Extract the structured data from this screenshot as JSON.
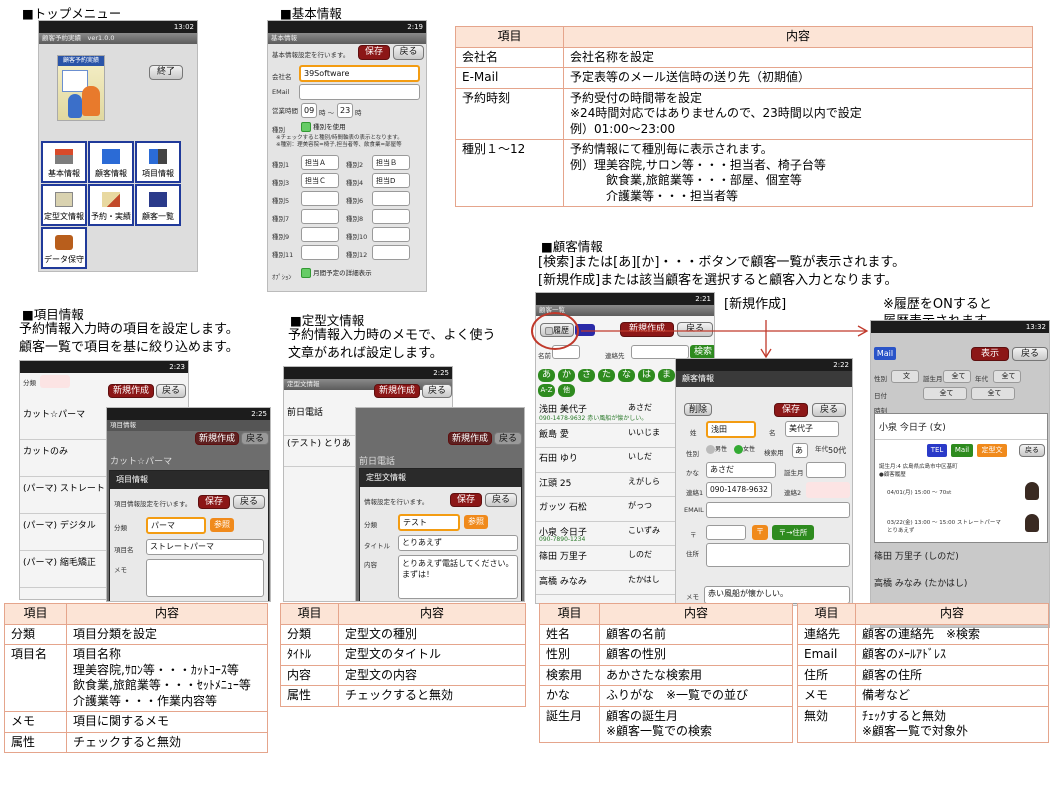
{
  "top_menu": {
    "heading": "■トップメニュー",
    "clock": "13:02",
    "app_title": "顧客予約実績　ver1.0.0",
    "logo_text": "顧客予約実績",
    "exit_label": "終了",
    "items": [
      "基本情報",
      "顧客情報",
      "項目情報",
      "定型文情報",
      "予約・実績",
      "顧客一覧",
      "データ保守"
    ]
  },
  "basic": {
    "heading": "■基本情報",
    "clock": "2:19",
    "title": "基本情報",
    "note": "基本情報設定を行います。",
    "save": "保存",
    "back": "戻る",
    "company_label": "会社名",
    "company_value": "39Software",
    "email_label": "EMail",
    "hours_label": "営業時間",
    "hour_from": "09",
    "hour_sep": "時 〜",
    "hour_to": "23",
    "hour_unit": "時",
    "type_label": "種別",
    "type_check": "種別を使用",
    "type_note1": "※チェックすると種別/時間軸表の表示となります。",
    "type_note2": "※種別：理美容院=椅子,担当者等、飲食業=部屋等",
    "rows": [
      {
        "l1": "種別1",
        "v1": "担当Ａ",
        "l2": "種別2",
        "v2": "担当Ｂ"
      },
      {
        "l1": "種別3",
        "v1": "担当Ｃ",
        "l2": "種別4",
        "v2": "担当D"
      },
      {
        "l1": "種別5",
        "v1": "",
        "l2": "種別6",
        "v2": ""
      },
      {
        "l1": "種別7",
        "v1": "",
        "l2": "種別8",
        "v2": ""
      },
      {
        "l1": "種別9",
        "v1": "",
        "l2": "種別10",
        "v2": ""
      },
      {
        "l1": "種別11",
        "v1": "",
        "l2": "種別12",
        "v2": ""
      }
    ],
    "option_label": "ｵﾌﾟｼｮﾝ",
    "option_check": "月間予定の詳細表示"
  },
  "basic_table": {
    "headers": [
      "項目",
      "内容"
    ],
    "rows": [
      {
        "k": "会社名",
        "v": "会社名称を設定"
      },
      {
        "k": "E-Mail",
        "v": "予定表等のメール送信時の送り先（初期値）"
      },
      {
        "k": "予約時刻",
        "v": "予約受付の時間帯を設定\n※24時間対応ではありませんので、23時間以内で設定\n例）01:00〜23:00"
      },
      {
        "k": "種別１〜12",
        "v": "予約情報にて種別毎に表示されます。\n例）理美容院,サロン等・・・担当者、椅子台等\n　　　飲食業,旅館業等・・・部屋、個室等\n　　　介護業等・・・担当者等"
      }
    ]
  },
  "item_info": {
    "heading": "■項目情報",
    "desc1": "予約情報入力時の項目を設定します。",
    "desc2": "顧客一覧で項目を基に絞り込めます。",
    "clock1": "2:23",
    "clock2": "2:25",
    "list_label": "分類",
    "new": "新規作成",
    "back": "戻る",
    "list": [
      "カット☆パーマ",
      "カットのみ",
      "(パーマ) ストレート",
      "(パーマ) デジタル",
      "(パーマ) 縮毛矯正"
    ],
    "bg_title": "項目情報",
    "bg_item": "カット☆パーマ",
    "dlg_title": "項目情報",
    "dlg_note": "項目情報設定を行います。",
    "save": "保存",
    "cat_label": "分類",
    "cat_value": "パーマ",
    "ref": "参照",
    "name_label": "項目名",
    "name_value": "ストレートパーマ",
    "memo_label": "メモ"
  },
  "item_table": {
    "headers": [
      "項目",
      "内容"
    ],
    "rows": [
      {
        "k": "分類",
        "v": "項目分類を設定"
      },
      {
        "k": "項目名",
        "v": "項目名称\n理美容院,ｻﾛﾝ等・・・ｶｯﾄｺｰｽ等\n飲食業,旅館業等・・・ｾｯﾄﾒﾆｭｰ等\n介護業等・・・作業内容等"
      },
      {
        "k": "メモ",
        "v": "項目に関するメモ"
      },
      {
        "k": "属性",
        "v": "チェックすると無効"
      }
    ]
  },
  "template": {
    "heading": "■定型文情報",
    "desc1": "予約情報入力時のメモで、よく使う",
    "desc2": "文章があれば設定します。",
    "clock1": "2:25",
    "title": "定型文情報",
    "new": "新規作成",
    "back": "戻る",
    "list": [
      "前日電話",
      "(テスト) とりあ"
    ],
    "bg_item": "前日電話",
    "dlg_title": "定型文情報",
    "dlg_note": "情報設定を行います。",
    "save": "保存",
    "cat_label": "分類",
    "cat_value": "テスト",
    "ref": "参照",
    "title_label": "タイトル",
    "title_value": "とりあえず",
    "body_label": "内容",
    "body_value": "とりあえず電話してください。\nまずは！"
  },
  "template_table": {
    "headers": [
      "項目",
      "内容"
    ],
    "rows": [
      {
        "k": "分類",
        "v": "定型文の種別"
      },
      {
        "k": "ﾀｲﾄﾙ",
        "v": "定型文のタイトル"
      },
      {
        "k": "内容",
        "v": "定型文の内容"
      },
      {
        "k": "属性",
        "v": "チェックすると無効"
      }
    ]
  },
  "customer": {
    "heading": "■顧客情報",
    "desc1": "[検索]または[あ][か]・・・ボタンで顧客一覧が表示されます。",
    "desc2": "[新規作成]または該当顧客を選択すると顧客入力となります。",
    "label_new": "[新規作成]",
    "label_hist1": "※履歴をONすると",
    "label_hist2": "履歴表示されます。",
    "clock1": "2:21",
    "clock2": "2:22",
    "clock3": "13:32",
    "title": "顧客一覧",
    "history_toggle": "履歴",
    "new": "新規作成",
    "back": "戻る",
    "name_label": "名前",
    "contact_label": "連絡先",
    "search": "検索",
    "kana_row": [
      "あ",
      "か",
      "さ",
      "た",
      "な",
      "は",
      "ま",
      "や"
    ],
    "kana_row2": [
      "A-Z",
      "他"
    ],
    "list": [
      {
        "name": "浅田 美代子",
        "kana": "あさだ",
        "sub": "090-1478-9632 赤い風船が懐かしい。"
      },
      {
        "name": "飯島 愛",
        "kana": "いいじま",
        "sub": ""
      },
      {
        "name": "石田 ゆり",
        "kana": "いしだ",
        "sub": ""
      },
      {
        "name": "江頭 25",
        "kana": "えがしら",
        "sub": ""
      },
      {
        "name": "ガッツ 石松",
        "kana": "がっつ",
        "sub": ""
      },
      {
        "name": "小泉 今日子",
        "kana": "こいずみ",
        "sub": "090-7890-1234"
      },
      {
        "name": "篠田 万里子",
        "kana": "しのだ",
        "sub": ""
      },
      {
        "name": "高橋 みなみ",
        "kana": "たかはし",
        "sub": ""
      }
    ],
    "form_title": "顧客情報",
    "delete": "削除",
    "save": "保存",
    "surname_label": "姓",
    "surname_value": "浅田",
    "given_label": "名",
    "given_value": "美代子",
    "gender_label": "性別",
    "male": "男性",
    "female": "女性",
    "search_label": "検索用",
    "search_value": "あ",
    "age_label": "年代",
    "age_value": "50代",
    "kana_label": "かな",
    "kana_value": "あさだ",
    "birth_label": "誕生月",
    "tel1_label": "連絡1",
    "tel1_value": "090-1478-9632",
    "tel2_label": "連絡2",
    "email_label": "EMAIL",
    "zip_label": "〒",
    "zip_btn": "〒",
    "addr_btn": "〒→住所",
    "addr_label": "住所",
    "memo_label": "メモ",
    "memo_value": "赤い風船が懐かしい。",
    "hist_mail_tab": "Mail",
    "hist_show": "表示",
    "hist_back": "戻る",
    "hist_row1": [
      "性別",
      "文",
      "誕生月",
      "全て",
      "年代",
      "全て"
    ],
    "hist_row2": [
      "日付",
      "全て"
    ],
    "hist_row3": [
      "時刻",
      "全て"
    ],
    "hist_card_name": "小泉 今日子 (女)",
    "hist_tel": "TEL",
    "hist_mail": "Mail",
    "hist_tpl": "定型文",
    "hist_back2": "戻る",
    "hist_addr": "誕生月:4 広島県広島市中区基町",
    "hist_memo": "●顧客履歴",
    "hist_rec1": "04/01(月) 15:00 〜 70st",
    "hist_rec2": "03/22(金) 13:00 〜 15:00 ストレートパーマ",
    "hist_rec2b": "とりあえず",
    "hist_list": [
      "篠田 万里子 (しのだ)",
      "高橋 みなみ (たかはし)"
    ]
  },
  "customer_table1": {
    "headers": [
      "項目",
      "内容"
    ],
    "rows": [
      {
        "k": "姓名",
        "v": "顧客の名前"
      },
      {
        "k": "性別",
        "v": "顧客の性別"
      },
      {
        "k": "検索用",
        "v": "あかさたな検索用"
      },
      {
        "k": "かな",
        "v": "ふりがな　※一覧での並び"
      },
      {
        "k": "誕生月",
        "v": "顧客の誕生月\n※顧客一覧での検索"
      }
    ]
  },
  "customer_table2": {
    "headers": [
      "項目",
      "内容"
    ],
    "rows": [
      {
        "k": "連絡先",
        "v": "顧客の連絡先　※検索"
      },
      {
        "k": "Email",
        "v": "顧客のﾒｰﾙｱﾄﾞﾚｽ"
      },
      {
        "k": "住所",
        "v": "顧客の住所"
      },
      {
        "k": "メモ",
        "v": "備考など"
      },
      {
        "k": "無効",
        "v": "ﾁｪｯｸすると無効\n※顧客一覧で対象外"
      }
    ]
  }
}
